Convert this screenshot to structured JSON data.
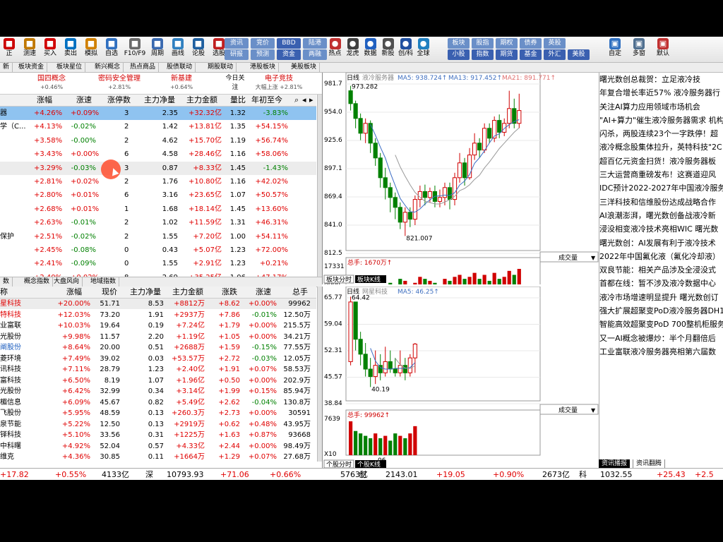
{
  "toolbar": {
    "buttons": [
      {
        "label": "正",
        "color": "#c00"
      },
      {
        "label": "测速",
        "color": "#c07800"
      },
      {
        "label": "买入",
        "color": "#d00000"
      },
      {
        "label": "卖出",
        "color": "#0070c0"
      },
      {
        "label": "模拟",
        "color": "#d08000"
      },
      {
        "label": "自选",
        "color": "#3070c0"
      },
      {
        "label": "F10/F9",
        "color": "#6a6a6a"
      },
      {
        "label": "周期",
        "color": "#3a6ab0"
      },
      {
        "label": "画线",
        "color": "#3080c0"
      },
      {
        "label": "论股",
        "color": "#2060a0"
      },
      {
        "label": "选股",
        "color": "#c02020"
      }
    ],
    "mini_top": [
      "资讯",
      "竞价",
      "BBD",
      "陆港"
    ],
    "mini_bot": [
      "研报",
      "预测",
      "资金",
      "两融"
    ],
    "right_buttons": [
      {
        "label": "热点",
        "color": "#c03030"
      },
      {
        "label": "龙虎",
        "color": "#404040"
      },
      {
        "label": "数据",
        "color": "#2060c0"
      },
      {
        "label": "新股",
        "color": "#505050"
      },
      {
        "label": "创/科",
        "color": "#2050a0"
      },
      {
        "label": "全球",
        "color": "#2080c0"
      }
    ],
    "mini2_top": [
      "板块",
      "股指",
      "期权",
      "债券",
      "英股"
    ],
    "mini2_bot": [
      "小股",
      "指数",
      "期货",
      "基金",
      "外汇",
      "美股"
    ],
    "far_right": [
      {
        "label": "自定",
        "color": "#3070c0"
      },
      {
        "label": "多窗",
        "color": "#507090"
      },
      {
        "label": "默认",
        "color": "#c03030"
      }
    ]
  },
  "tabs": [
    "新",
    "板块资金",
    "板块星位",
    "新兴概念",
    "热点商品",
    "股债联动",
    "期股联动",
    "港股板块",
    "美股板块"
  ],
  "concepts": [
    {
      "name": "国四概念",
      "value": "+0.46%"
    },
    {
      "name": "密码安全管理",
      "value": "+2.81%"
    },
    {
      "name": "新基建",
      "value": "+0.64%"
    },
    {
      "name": "今日关注",
      "value": ""
    },
    {
      "name": "电子竞技",
      "value": "大幅上涨 +2.81%"
    }
  ],
  "upper_table": {
    "columns": [
      "涨幅",
      "涨速",
      "涨停数",
      "主力净量",
      "主力金额",
      "量比",
      "年初至今"
    ],
    "rows": [
      {
        "name": "器",
        "pct": "+4.26%",
        "spd": "+0.09%",
        "zt": "3",
        "jl": "2.35",
        "je": "+32.32亿",
        "lb": "1.32",
        "nc": "-3.83%"
      },
      {
        "name": "学（C...",
        "pct": "+4.13%",
        "spd": "-0.02%",
        "zt": "2",
        "jl": "1.42",
        "je": "+13.81亿",
        "lb": "1.35",
        "nc": "+54.15%"
      },
      {
        "name": "",
        "pct": "+3.58%",
        "spd": "-0.00%",
        "zt": "2",
        "jl": "4.62",
        "je": "+15.70亿",
        "lb": "1.19",
        "nc": "+56.74%"
      },
      {
        "name": "",
        "pct": "+3.43%",
        "spd": "+0.00%",
        "zt": "6",
        "jl": "4.58",
        "je": "+28.46亿",
        "lb": "1.16",
        "nc": "+58.06%"
      },
      {
        "name": "",
        "pct": "+3.29%",
        "spd": "-0.03%",
        "zt": "3",
        "jl": "0.87",
        "je": "+8.33亿",
        "lb": "1.45",
        "nc": "-1.43%"
      },
      {
        "name": "",
        "pct": "+2.81%",
        "spd": "+0.02%",
        "zt": "2",
        "jl": "1.76",
        "je": "+10.80亿",
        "lb": "1.16",
        "nc": "+42.02%"
      },
      {
        "name": "",
        "pct": "+2.80%",
        "spd": "+0.01%",
        "zt": "6",
        "jl": "3.16",
        "je": "+23.65亿",
        "lb": "1.07",
        "nc": "+50.57%"
      },
      {
        "name": "",
        "pct": "+2.68%",
        "spd": "+0.01%",
        "zt": "1",
        "jl": "1.68",
        "je": "+18.14亿",
        "lb": "1.45",
        "nc": "+13.60%"
      },
      {
        "name": "",
        "pct": "+2.63%",
        "spd": "-0.01%",
        "zt": "2",
        "jl": "1.02",
        "je": "+11.59亿",
        "lb": "1.31",
        "nc": "+46.31%"
      },
      {
        "name": "保护",
        "pct": "+2.51%",
        "spd": "-0.02%",
        "zt": "2",
        "jl": "1.55",
        "je": "+7.20亿",
        "lb": "1.00",
        "nc": "+54.11%"
      },
      {
        "name": "",
        "pct": "+2.45%",
        "spd": "-0.08%",
        "zt": "0",
        "jl": "0.43",
        "je": "+5.07亿",
        "lb": "1.23",
        "nc": "+72.00%"
      },
      {
        "name": "",
        "pct": "+2.41%",
        "spd": "-0.09%",
        "zt": "0",
        "jl": "1.55",
        "je": "+2.91亿",
        "lb": "1.23",
        "nc": "+0.21%"
      },
      {
        "name": "",
        "pct": "+2.40%",
        "spd": "+0.02%",
        "zt": "8",
        "jl": "2.69",
        "je": "+35.25亿",
        "lb": "1.06",
        "nc": "+47.17%"
      }
    ]
  },
  "mid_tabs": [
    "数",
    "概念指数",
    "大盘风向",
    "地域指数"
  ],
  "lower_table": {
    "columns": [
      "称",
      "涨幅",
      "现价",
      "主力净量",
      "主力金额",
      "涨跌",
      "涨速",
      "总手"
    ],
    "rows": [
      {
        "name": "星科技",
        "pct": "+20.00%",
        "px": "51.71",
        "jl": "8.53",
        "je": "+8812万",
        "zd": "+8.62",
        "spd": "+0.00%",
        "zs": "99962",
        "nc": "r"
      },
      {
        "name": "特科技",
        "pct": "+12.03%",
        "px": "73.20",
        "jl": "1.91",
        "je": "+2937万",
        "zd": "+7.86",
        "spd": "-0.01%",
        "zs": "12.50万",
        "nc": "r"
      },
      {
        "name": "业富联",
        "pct": "+10.03%",
        "px": "19.64",
        "jl": "0.19",
        "je": "+7.24亿",
        "zd": "+1.79",
        "spd": "+0.00%",
        "zs": "215.5万",
        "nc": "k"
      },
      {
        "name": "光股份",
        "pct": "+9.98%",
        "px": "11.57",
        "jl": "2.20",
        "je": "+1.19亿",
        "zd": "+1.05",
        "spd": "+0.00%",
        "zs": "34.21万",
        "nc": "k"
      },
      {
        "name": "阐股份",
        "pct": "+8.64%",
        "px": "20.00",
        "jl": "0.51",
        "je": "+2688万",
        "zd": "+1.59",
        "spd": "-0.15%",
        "zs": "77.55万",
        "nc": "b"
      },
      {
        "name": "菱环境",
        "pct": "+7.49%",
        "px": "39.02",
        "jl": "0.03",
        "je": "+53.57万",
        "zd": "+2.72",
        "spd": "-0.03%",
        "zs": "12.05万",
        "nc": "k"
      },
      {
        "name": "讯科技",
        "pct": "+7.11%",
        "px": "28.79",
        "jl": "1.23",
        "je": "+2.40亿",
        "zd": "+1.91",
        "spd": "+0.07%",
        "zs": "58.53万",
        "nc": "k"
      },
      {
        "name": "富科技",
        "pct": "+6.50%",
        "px": "8.19",
        "jl": "1.07",
        "je": "+1.96亿",
        "zd": "+0.50",
        "spd": "+0.00%",
        "zs": "202.9万",
        "nc": "k"
      },
      {
        "name": "光股份",
        "pct": "+6.42%",
        "px": "32.99",
        "jl": "0.34",
        "je": "+3.14亿",
        "zd": "+1.99",
        "spd": "+0.15%",
        "zs": "85.94万",
        "nc": "k"
      },
      {
        "name": "楣信息",
        "pct": "+6.09%",
        "px": "45.67",
        "jl": "0.82",
        "je": "+5.49亿",
        "zd": "+2.62",
        "spd": "-0.04%",
        "zs": "130.8万",
        "nc": "k"
      },
      {
        "name": "飞股份",
        "pct": "+5.95%",
        "px": "48.59",
        "jl": "0.13",
        "je": "+260.3万",
        "zd": "+2.73",
        "spd": "+0.00%",
        "zs": "30591",
        "nc": "k"
      },
      {
        "name": "泉节能",
        "pct": "+5.22%",
        "px": "12.50",
        "jl": "0.13",
        "je": "+2919万",
        "zd": "+0.62",
        "spd": "+0.48%",
        "zs": "43.95万",
        "nc": "k"
      },
      {
        "name": "铎科技",
        "pct": "+5.10%",
        "px": "33.56",
        "jl": "0.31",
        "je": "+1225万",
        "zd": "+1.63",
        "spd": "+0.87%",
        "zs": "93668",
        "nc": "k"
      },
      {
        "name": "中科曙",
        "pct": "+4.92%",
        "px": "52.04",
        "jl": "0.57",
        "je": "+4.33亿",
        "zd": "+2.44",
        "spd": "+0.00%",
        "zs": "98.49万",
        "nc": "k"
      },
      {
        "name": "维克",
        "pct": "+4.36%",
        "px": "30.85",
        "jl": "0.11",
        "je": "+1664万",
        "zd": "+1.29",
        "spd": "+0.07%",
        "zs": "27.68万",
        "nc": "k"
      }
    ]
  },
  "chart_top": {
    "header": {
      "period": "日线",
      "name": "液冷服务器",
      "ma5": "MA5: 938.724↑",
      "ma13": "MA13: 917.452↑",
      "ma21": "MA21: 891.771↑"
    },
    "price_axis": [
      "981.7",
      "954.0",
      "925.6",
      "897.1",
      "869.4",
      "841.0",
      "812.5"
    ],
    "high_label": "973.282",
    "low_label": "821.007",
    "vol_header": "总手: 1670万↑",
    "vol_axis": [
      "17331",
      "8666",
      "X100"
    ],
    "x_labels": [
      "04",
      "05",
      "06"
    ],
    "vol_dropdown": "成交量",
    "tabs": [
      "板块分时",
      "板块K线"
    ]
  },
  "chart_bottom": {
    "header": {
      "period": "日线",
      "name": "网星科技",
      "ma5": "MA5: 46.25↑"
    },
    "price_axis": [
      "65.77",
      "59.04",
      "52.31",
      "45.57",
      "38.84"
    ],
    "high_label": "64.42",
    "low_label": "40.19",
    "vol_header": "总手: 99962↑",
    "vol_axis": [
      "7639",
      "X10"
    ],
    "x_labels": [
      "06"
    ],
    "vol_dropdown": "成交量",
    "tabs": [
      "个股分时",
      "个股K线"
    ]
  },
  "news": [
    "曙光数创总裁贺：立足液冷技",
    "年复合增长率近57% 液冷服务器行",
    "关注AI算力应用领域市场机会",
    "\"AI+算力\"催生液冷服务器需求 机构",
    "闪杀，两股连续23个一字跌停！超",
    "液冷概念股集体拉升，英特科技\"2C",
    "超百亿元资金扫货！液冷服务器板",
    "三大运营商重磅发布！这赛道迎风",
    "IDC预计2022-2027年中国液冷服务器",
    "三洋科技和信维股份达成战略合作",
    "AI浪潮澎湃，曙光数创备战液冷新",
    "浸没相变液冷技术亮相WIC 曙光数",
    "曙光数创：AI发展有利于液冷技术",
    "2022年中国氟化液（氟化冷却液）",
    "双良节能：相关产品涉及全浸没式",
    "首都在线：暂不涉及液冷数据中心",
    "液冷市场增速明显提升 曙光数创订",
    "强大扩展超聚变PoD液冷服务器DH1",
    "智能高效超聚变PoD 700整机柜服务",
    "又一AI概念被爆炒：半个月翻倍后",
    "工业富联液冷服务器亮相第六届数"
  ],
  "news_tabs": [
    "资讯播报",
    "资讯翻腾"
  ],
  "status": [
    {
      "t": "+17.82",
      "c": "r"
    },
    {
      "t": "+0.55%",
      "c": "r"
    },
    {
      "t": "4133亿",
      "c": "k"
    },
    {
      "t": "深",
      "c": "k"
    },
    {
      "t": "10793.93",
      "c": "k"
    },
    {
      "t": "+71.06",
      "c": "r"
    },
    {
      "t": "+0.66%",
      "c": "r"
    },
    {
      "t": "5763亿",
      "c": "k"
    },
    {
      "t": "创",
      "c": "k"
    },
    {
      "t": "2143.01",
      "c": "k"
    },
    {
      "t": "+19.05",
      "c": "r"
    },
    {
      "t": "+0.90%",
      "c": "r"
    },
    {
      "t": "2673亿",
      "c": "k"
    },
    {
      "t": "科",
      "c": "k"
    },
    {
      "t": "1032.55",
      "c": "k"
    },
    {
      "t": "+25.43",
      "c": "r"
    },
    {
      "t": "+2.5",
      "c": "r"
    }
  ]
}
